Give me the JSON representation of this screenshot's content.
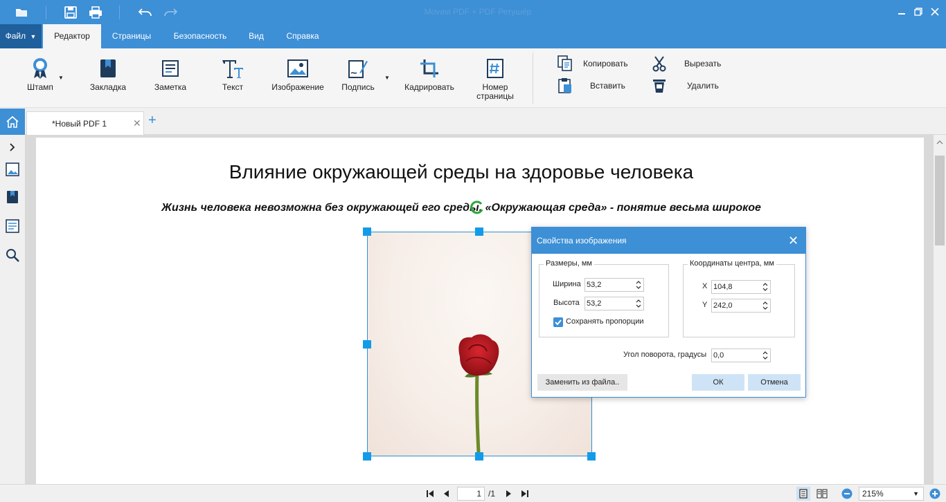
{
  "window": {
    "title": "Movavi PDF + PDF Ретушёр"
  },
  "tabs": {
    "file": "Файл",
    "editor": "Редактор",
    "pages": "Страницы",
    "security": "Безопасность",
    "view": "Вид",
    "help": "Справка"
  },
  "ribbon": {
    "stamp": "Штамп",
    "bookmark": "Закладка",
    "note": "Заметка",
    "text": "Текст",
    "image": "Изображение",
    "signature": "Подпись",
    "crop": "Кадрировать",
    "page_number_1": "Номер",
    "page_number_2": "страницы",
    "copy": "Копировать",
    "paste": "Вставить",
    "cut": "Вырезать",
    "delete": "Удалить"
  },
  "doctab": {
    "name": "*Новый PDF 1"
  },
  "document": {
    "title": "Влияние окружающей среды на здоровье человека",
    "subtitle": "Жизнь человека невозможна без окружающей его среды. «Окружающая среда» - понятие весьма широкое"
  },
  "dialog": {
    "title": "Свойства изображения",
    "size_group": "Размеры, мм",
    "width_label": "Ширина",
    "width_value": "53,2",
    "height_label": "Высота",
    "height_value": "53,2",
    "keep_ratio": "Сохранять пропорции",
    "center_group": "Координаты центра, мм",
    "x_label": "X",
    "x_value": "104,8",
    "y_label": "Y",
    "y_value": "242,0",
    "rotation_label": "Угол поворота, градусы",
    "rotation_value": "0,0",
    "replace_button": "Заменить из файла..",
    "ok_button": "ОК",
    "cancel_button": "Отмена"
  },
  "status": {
    "current_page": "1",
    "total_pages": "/1",
    "zoom": "215%"
  },
  "colors": {
    "accent": "#3d8fd6",
    "accent_dark": "#1e5f9c",
    "handle": "#139be8"
  }
}
